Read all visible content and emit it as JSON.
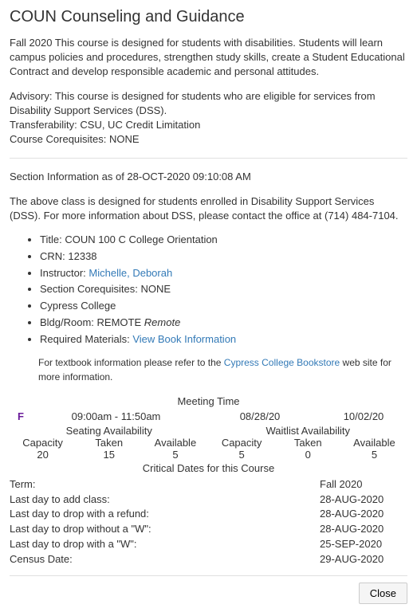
{
  "title": "COUN Counseling and Guidance",
  "description": "Fall 2020 This course is designed for students with disabilities. Students will learn campus policies and procedures, strengthen study skills, create a Student Educational Contract and develop responsible academic and personal attitudes.",
  "advisory": "Advisory: This course is designed for students who are eligible for services from Disability Support Services (DSS).",
  "transferability": "Transferability: CSU, UC Credit Limitation",
  "corequisites_course": "Course Corequisites: NONE",
  "section_info_heading": "Section Information as of 28-OCT-2020 09:10:08 AM",
  "section_note": "The above class is designed for students enrolled in Disability Support Services (DSS). For more information about DSS, please contact the office at (714) 484-7104.",
  "details": {
    "title_label": "Title: ",
    "title_value": "COUN 100 C College Orientation",
    "crn_label": "CRN: ",
    "crn_value": "12338",
    "instructor_label": "Instructor: ",
    "instructor_value": "Michelle, Deborah",
    "section_coreq_label": "Section Corequisites: ",
    "section_coreq_value": "NONE",
    "college": "Cypress College",
    "bldg_label": "Bldg/Room: ",
    "bldg_value": "REMOTE ",
    "bldg_italic": "Remote",
    "materials_label": "Required Materials: ",
    "materials_link": "View Book Information"
  },
  "textbook_note_pre": "For textbook information please refer to the ",
  "textbook_link": "Cypress College Bookstore",
  "textbook_note_post": " web site for more information.",
  "meeting": {
    "heading": "Meeting Time",
    "day_letter": "F",
    "time": "09:00am - 11:50am",
    "start": "08/28/20",
    "end": "10/02/20"
  },
  "availability": {
    "seating_label": "Seating Availability",
    "waitlist_label": "Waitlist Availability",
    "capacity_h": "Capacity",
    "taken_h": "Taken",
    "available_h": "Available",
    "seating": {
      "capacity": "20",
      "taken": "15",
      "available": "5"
    },
    "waitlist": {
      "capacity": "5",
      "taken": "0",
      "available": "5"
    }
  },
  "critical": {
    "heading": "Critical Dates for this Course",
    "rows": [
      {
        "label": "Term:",
        "value": "Fall 2020"
      },
      {
        "label": "Last day to add class:",
        "value": "28-AUG-2020"
      },
      {
        "label": "Last day to drop with a refund:",
        "value": "28-AUG-2020"
      },
      {
        "label": "Last day to drop without a \"W\":",
        "value": "28-AUG-2020"
      },
      {
        "label": "Last day to drop with a \"W\":",
        "value": "25-SEP-2020"
      },
      {
        "label": "Census Date:",
        "value": "29-AUG-2020"
      }
    ]
  },
  "close_label": "Close"
}
